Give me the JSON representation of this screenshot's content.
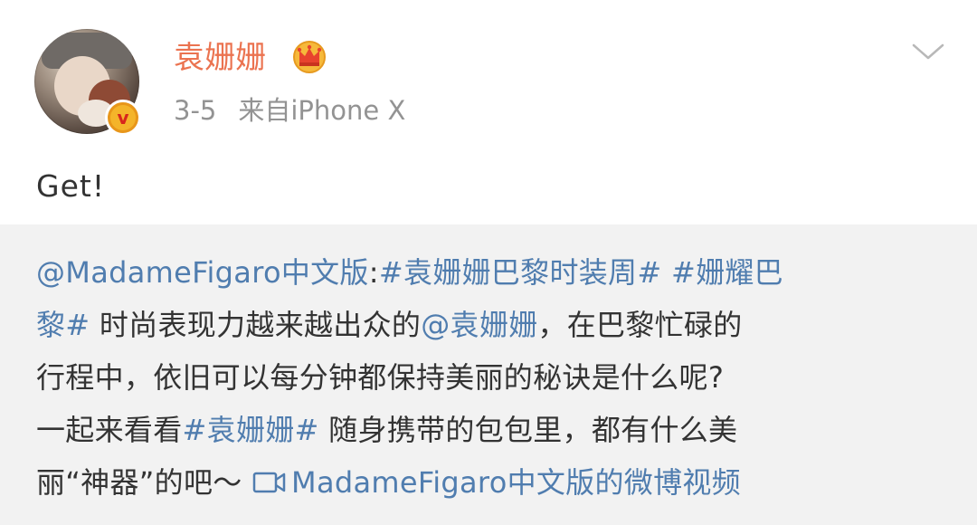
{
  "post": {
    "username": "袁姗姗",
    "date": "3-5",
    "source": "来自iPhone X",
    "text": "Get!",
    "icons": {
      "verified": "verified-v-badge",
      "crown": "crown-icon",
      "menu": "chevron-down-icon",
      "video": "video-icon"
    },
    "colors": {
      "username": "#eb7350",
      "link": "#507daf",
      "repost_bg": "#f2f2f2",
      "meta": "#939393",
      "badge": "#e8961a"
    }
  },
  "repost": {
    "author_mention": "@MadameFigaro中文版",
    "colon": ":",
    "topic1": "#袁姗姗巴黎时装周#",
    "topic2a": "#姗耀巴",
    "topic2b": "黎#",
    "text1": "时尚表现力越来越出众的",
    "mention": "@袁姗姗",
    "text2": "，在巴黎忙碌的",
    "line3": "行程中，依旧可以每分钟都保持美丽的秘诀是什么呢?",
    "text3": "一起来看看",
    "topic3": "#袁姗姗#",
    "text4": "随身携带的包包里，都有什么美",
    "text5": "丽“神器”的吧～",
    "video_link": "MadameFigaro中文版的微博视频",
    "verified_letter": "v"
  }
}
